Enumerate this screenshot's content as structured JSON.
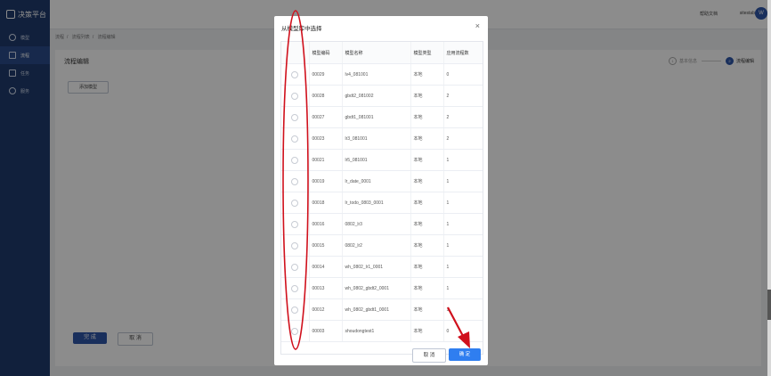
{
  "app": {
    "logo_text": "决策平台",
    "nav": [
      {
        "label": "模型",
        "icon": "model-icon"
      },
      {
        "label": "流程",
        "icon": "flow-icon"
      },
      {
        "label": "任务",
        "icon": "task-icon"
      },
      {
        "label": "服务",
        "icon": "service-icon"
      }
    ],
    "active_nav": "流程"
  },
  "header": {
    "help": "帮助文档",
    "user": "sitestab",
    "avatar": "W"
  },
  "breadcrumb": [
    "流程",
    "流程列表",
    "流程编辑"
  ],
  "page": {
    "title": "流程编辑",
    "add_model": "添加模型",
    "steps": [
      {
        "index": "1",
        "label": "基本信息"
      },
      {
        "index": "2",
        "label": "流程编辑"
      }
    ],
    "finish": "完 成",
    "cancel": "取 消"
  },
  "modal": {
    "title": "从模型库中选择",
    "close": "×",
    "columns": [
      "",
      "模型编码",
      "模型名称",
      "模型类型",
      "应用流程数"
    ],
    "rows": [
      {
        "code": "00029",
        "name": "lv4_081001",
        "type": "本地",
        "count": "0"
      },
      {
        "code": "00028",
        "name": "gbdt2_081002",
        "type": "本地",
        "count": "2"
      },
      {
        "code": "00027",
        "name": "gbdt1_081001",
        "type": "本地",
        "count": "2"
      },
      {
        "code": "00023",
        "name": "lr3_081001",
        "type": "本地",
        "count": "2"
      },
      {
        "code": "00021",
        "name": "lr5_081001",
        "type": "本地",
        "count": "1"
      },
      {
        "code": "00019",
        "name": "lr_date_0001",
        "type": "本地",
        "count": "1"
      },
      {
        "code": "00018",
        "name": "lr_todo_0803_0001",
        "type": "本地",
        "count": "1"
      },
      {
        "code": "00016",
        "name": "0802_lr3",
        "type": "本地",
        "count": "1"
      },
      {
        "code": "00015",
        "name": "0802_lr2",
        "type": "本地",
        "count": "1"
      },
      {
        "code": "00014",
        "name": "wh_0802_lr1_0001",
        "type": "本地",
        "count": "1"
      },
      {
        "code": "00013",
        "name": "wh_0802_gbdt2_0001",
        "type": "本地",
        "count": "1"
      },
      {
        "code": "00012",
        "name": "wh_0802_gbdt1_0001",
        "type": "本地",
        "count": "1"
      },
      {
        "code": "00003",
        "name": "shoudongtest1",
        "type": "本地",
        "count": "0"
      }
    ],
    "cancel": "取 消",
    "ok": "确 定"
  },
  "annotation_colors": {
    "highlight": "#d0101c"
  }
}
